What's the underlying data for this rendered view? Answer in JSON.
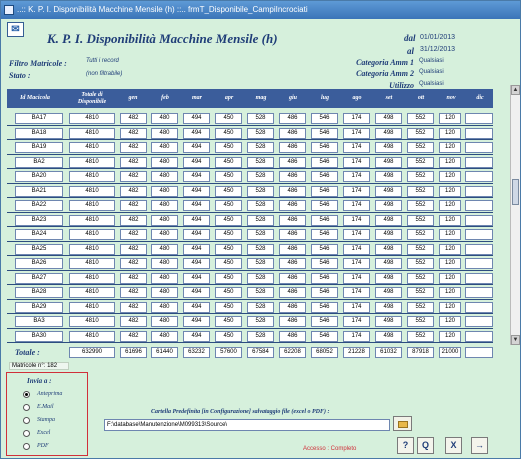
{
  "window": {
    "title": "..:: K. P. I.  Disponibilità Macchine Mensile (h) ::..    frmT_Disponibile_CampiIncrociati"
  },
  "header": {
    "title": "K. P. I.  Disponibilità Macchine Mensile (h)",
    "dal_label": "dal",
    "dal_value": "01/01/2013",
    "al_label": "al",
    "al_value": "31/12/2013"
  },
  "filters": {
    "filtro_label": "Filtro Matricole :",
    "filtro_value": "Tutti i record",
    "stato_label": "Stato :",
    "stato_value": "(non filtrabile)",
    "cat1_label": "Categoria Amm 1",
    "cat1_value": "Qualsiasi",
    "cat2_label": "Categoria Amm 2",
    "cat2_value": "Qualsiasi",
    "utilizzo_label": "Utilizzo",
    "utilizzo_value": "Qualsiasi"
  },
  "table": {
    "columns": [
      "Id Macicola",
      "Totale di Disponibile",
      "gen",
      "feb",
      "mar",
      "apr",
      "mag",
      "giu",
      "lug",
      "ago",
      "set",
      "ott",
      "nov",
      "dic"
    ],
    "rows": [
      [
        "BA17",
        "4810",
        "482",
        "480",
        "494",
        "450",
        "528",
        "486",
        "546",
        "174",
        "498",
        "552",
        "120",
        ""
      ],
      [
        "BA18",
        "4810",
        "482",
        "480",
        "494",
        "450",
        "528",
        "486",
        "546",
        "174",
        "498",
        "552",
        "120",
        ""
      ],
      [
        "BA19",
        "4810",
        "482",
        "480",
        "494",
        "450",
        "528",
        "486",
        "546",
        "174",
        "498",
        "552",
        "120",
        ""
      ],
      [
        "BA2",
        "4810",
        "482",
        "480",
        "494",
        "450",
        "528",
        "486",
        "546",
        "174",
        "498",
        "552",
        "120",
        ""
      ],
      [
        "BA20",
        "4810",
        "482",
        "480",
        "494",
        "450",
        "528",
        "486",
        "546",
        "174",
        "498",
        "552",
        "120",
        ""
      ],
      [
        "BA21",
        "4810",
        "482",
        "480",
        "494",
        "450",
        "528",
        "486",
        "546",
        "174",
        "498",
        "552",
        "120",
        ""
      ],
      [
        "BA22",
        "4810",
        "482",
        "480",
        "494",
        "450",
        "528",
        "486",
        "546",
        "174",
        "498",
        "552",
        "120",
        ""
      ],
      [
        "BA23",
        "4810",
        "482",
        "480",
        "494",
        "450",
        "528",
        "486",
        "546",
        "174",
        "498",
        "552",
        "120",
        ""
      ],
      [
        "BA24",
        "4810",
        "482",
        "480",
        "494",
        "450",
        "528",
        "486",
        "546",
        "174",
        "498",
        "552",
        "120",
        ""
      ],
      [
        "BA25",
        "4810",
        "482",
        "480",
        "494",
        "450",
        "528",
        "486",
        "546",
        "174",
        "498",
        "552",
        "120",
        ""
      ],
      [
        "BA26",
        "4810",
        "482",
        "480",
        "494",
        "450",
        "528",
        "486",
        "546",
        "174",
        "498",
        "552",
        "120",
        ""
      ],
      [
        "BA27",
        "4810",
        "482",
        "480",
        "494",
        "450",
        "528",
        "486",
        "546",
        "174",
        "498",
        "552",
        "120",
        ""
      ],
      [
        "BA28",
        "4810",
        "482",
        "480",
        "494",
        "450",
        "528",
        "486",
        "546",
        "174",
        "498",
        "552",
        "120",
        ""
      ],
      [
        "BA29",
        "4810",
        "482",
        "480",
        "494",
        "450",
        "528",
        "486",
        "546",
        "174",
        "498",
        "552",
        "120",
        ""
      ],
      [
        "BA3",
        "4810",
        "482",
        "480",
        "494",
        "450",
        "528",
        "486",
        "546",
        "174",
        "498",
        "552",
        "120",
        ""
      ],
      [
        "BA30",
        "4810",
        "482",
        "480",
        "494",
        "450",
        "528",
        "486",
        "546",
        "174",
        "498",
        "552",
        "120",
        ""
      ]
    ]
  },
  "totals": {
    "label": "Totale :",
    "values": [
      "632990",
      "61696",
      "61440",
      "63232",
      "57600",
      "67584",
      "62208",
      "68052",
      "21228",
      "61032",
      "87918",
      "21000",
      ""
    ]
  },
  "matricole_count": "Matricole n°: 182",
  "invia": {
    "title": "Invia a :",
    "options": [
      "Anteprima",
      "E.Mail",
      "Stampa",
      "Excel",
      "PDF"
    ],
    "selected": "Anteprima"
  },
  "output": {
    "path_label": "Cartella Predefinita [in Configurazione] salvataggio file (excel o PDF)  :",
    "path_value": "F:\\database\\Manutenzione\\M099313\\Source\\"
  },
  "access_text": "Accesso : Completo",
  "toolbar": {
    "help": "?",
    "preview": "Q",
    "excel": "X",
    "exit": "→"
  },
  "colors": {
    "header_bg": "#3b5d9b",
    "window_bg": "#d6f0dc",
    "accent_red": "#d0303a",
    "title_text": "#1f3d78"
  }
}
